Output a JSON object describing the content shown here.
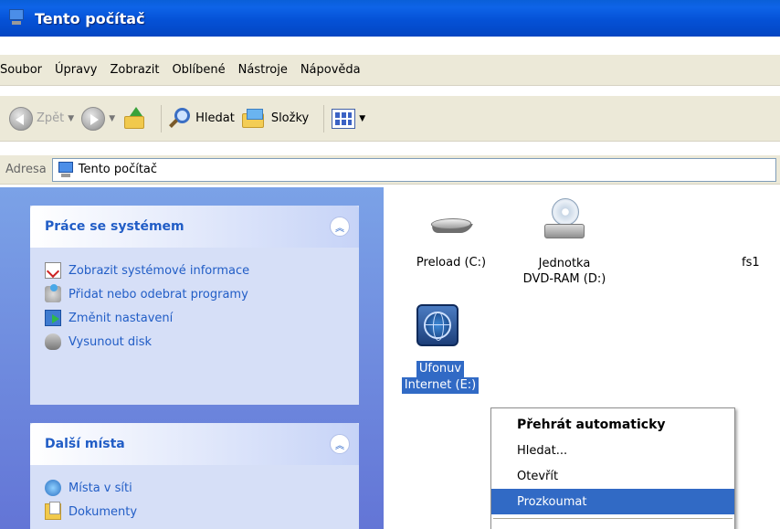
{
  "window": {
    "title": "Tento počítač"
  },
  "menu": [
    "Soubor",
    "Úpravy",
    "Zobrazit",
    "Oblíbené",
    "Nástroje",
    "Nápověda"
  ],
  "toolbar": {
    "back": "Zpět",
    "search": "Hledat",
    "folders": "Složky"
  },
  "address": {
    "label": "Adresa",
    "value": "Tento počítač"
  },
  "system_tasks": {
    "title": "Práce se systémem",
    "items": [
      "Zobrazit systémové informace",
      "Přidat nebo odebrat programy",
      "Změnit nastavení",
      "Vysunout disk"
    ]
  },
  "other_places": {
    "title": "Další místa",
    "items": [
      "Místa v síti",
      "Dokumenty"
    ]
  },
  "drives": [
    {
      "label": "Preload (C:)"
    },
    {
      "label_line1": "Jednotka",
      "label_line2": "DVD-RAM (D:)"
    },
    {
      "label": "fs1"
    },
    {
      "label_line1": "Ufonuv",
      "label_line2": "Internet (E:)"
    }
  ],
  "context_menu": [
    "Přehrát automaticky",
    "Hledat...",
    "Otevřít",
    "Prozkoumat"
  ],
  "colors": {
    "titlebar": "#0551d6",
    "selection": "#316ac5",
    "taskpane": "#6f8ede"
  }
}
